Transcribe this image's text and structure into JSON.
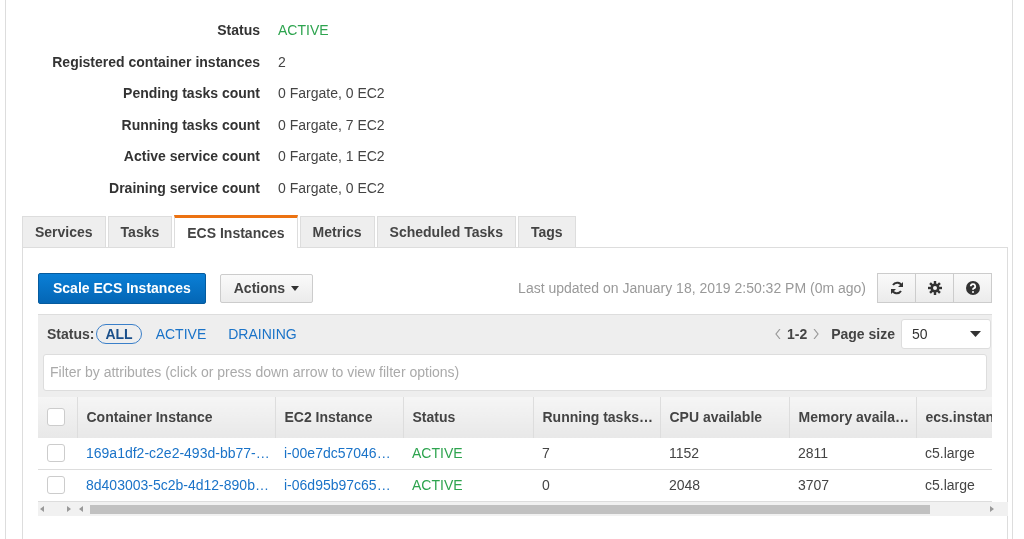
{
  "details": [
    {
      "label": "Status",
      "value": "ACTIVE",
      "kind": "status"
    },
    {
      "label": "Registered container instances",
      "value": "2",
      "kind": "text"
    },
    {
      "label": "Pending tasks count",
      "value": "0 Fargate, 0 EC2",
      "kind": "text"
    },
    {
      "label": "Running tasks count",
      "value": "0 Fargate, 7 EC2",
      "kind": "text"
    },
    {
      "label": "Active service count",
      "value": "0 Fargate, 1 EC2",
      "kind": "text"
    },
    {
      "label": "Draining service count",
      "value": "0 Fargate, 0 EC2",
      "kind": "text"
    }
  ],
  "tabs": [
    {
      "label": "Services",
      "selected": false
    },
    {
      "label": "Tasks",
      "selected": false
    },
    {
      "label": "ECS Instances",
      "selected": true
    },
    {
      "label": "Metrics",
      "selected": false
    },
    {
      "label": "Scheduled Tasks",
      "selected": false
    },
    {
      "label": "Tags",
      "selected": false
    }
  ],
  "toolbar": {
    "primary_button": "Scale ECS Instances",
    "actions_button": "Actions",
    "last_updated": "Last updated on January 18, 2019 2:50:32 PM (0m ago)"
  },
  "status_filter": {
    "label": "Status:",
    "options": [
      {
        "label": "ALL",
        "selected": true
      },
      {
        "label": "ACTIVE",
        "selected": false
      },
      {
        "label": "DRAINING",
        "selected": false
      }
    ]
  },
  "pagination": {
    "range": "1-2",
    "page_size_label": "Page size",
    "page_size": "50"
  },
  "filter": {
    "placeholder": "Filter by attributes (click or press down arrow to view filter options)"
  },
  "table": {
    "all_checked": false,
    "columns": [
      "Container Instance",
      "EC2 Instance",
      "Status",
      "Running tasks…",
      "CPU available",
      "Memory availa…",
      "ecs.instan"
    ],
    "rows": [
      {
        "checked": false,
        "cells": [
          "169a1df2-c2e2-493d-bb77-…",
          "i-00e7dc57046…",
          "ACTIVE",
          "7",
          "1152",
          "2811",
          "c5.large"
        ]
      },
      {
        "checked": false,
        "cells": [
          "8d403003-5c2b-4d12-890b…",
          "i-06d95b97c65…",
          "ACTIVE",
          "0",
          "2048",
          "3707",
          "c5.large"
        ]
      }
    ]
  }
}
